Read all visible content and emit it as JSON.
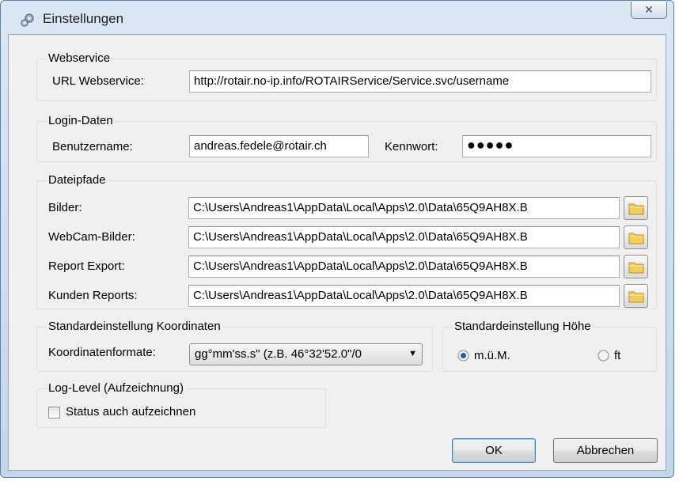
{
  "window": {
    "title": "Einstellungen",
    "close_glyph": "✕",
    "icon": "gears-icon"
  },
  "webservice": {
    "legend": "Webservice",
    "url_label": "URL Webservice:",
    "url_value": "http://rotair.no-ip.info/ROTAIRService/Service.svc/username"
  },
  "login": {
    "legend": "Login-Daten",
    "username_label": "Benutzername:",
    "username_value": "andreas.fedele@rotair.ch",
    "password_label": "Kennwort:",
    "password_mask": "●●●●●"
  },
  "paths": {
    "legend": "Dateipfade",
    "icon": "folder-icon",
    "rows": [
      {
        "label": "Bilder:",
        "value": "C:\\Users\\Andreas1\\AppData\\Local\\Apps\\2.0\\Data\\65Q9AH8X.B"
      },
      {
        "label": "WebCam-Bilder:",
        "value": "C:\\Users\\Andreas1\\AppData\\Local\\Apps\\2.0\\Data\\65Q9AH8X.B"
      },
      {
        "label": "Report Export:",
        "value": "C:\\Users\\Andreas1\\AppData\\Local\\Apps\\2.0\\Data\\65Q9AH8X.B"
      },
      {
        "label": "Kunden Reports:",
        "value": "C:\\Users\\Andreas1\\AppData\\Local\\Apps\\2.0\\Data\\65Q9AH8X.B"
      }
    ]
  },
  "coords": {
    "legend": "Standardeinstellung Koordinaten",
    "format_label": "Koordinatenformate:",
    "format_value": "gg°mm'ss.s\" (z.B. 46°32'52.0\"/0"
  },
  "height": {
    "legend": "Standardeinstellung Höhe",
    "options": [
      {
        "label": "m.ü.M.",
        "selected": true
      },
      {
        "label": "ft",
        "selected": false
      }
    ]
  },
  "log": {
    "legend": "Log-Level (Aufzeichnung)",
    "checkbox_label": "Status auch aufzeichnen",
    "checked": false
  },
  "buttons": {
    "ok": "OK",
    "cancel": "Abbrechen"
  },
  "colors": {
    "title_bar": "#c3d6ea",
    "dialog_bg": "#f0f0f0",
    "focus_border": "#3c7fb1",
    "radio_selected": "#1f5fa0"
  }
}
